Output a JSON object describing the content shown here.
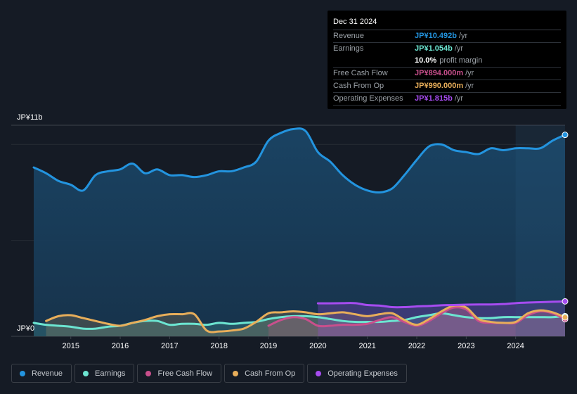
{
  "tooltip": {
    "date": "Dec 31 2024",
    "rows": [
      {
        "label": "Revenue",
        "value": "JP¥10.492b",
        "unit": "/yr",
        "color": "#2394df"
      },
      {
        "label": "Earnings",
        "value": "JP¥1.054b",
        "unit": "/yr",
        "color": "#6ce5d1"
      },
      {
        "label": "",
        "value": "10.0%",
        "unit": "profit margin",
        "color": "#ffffff"
      },
      {
        "label": "Free Cash Flow",
        "value": "JP¥894.000m",
        "unit": "/yr",
        "color": "#c94f8c"
      },
      {
        "label": "Cash From Op",
        "value": "JP¥990.000m",
        "unit": "/yr",
        "color": "#e8ae5a"
      },
      {
        "label": "Operating Expenses",
        "value": "JP¥1.815b",
        "unit": "/yr",
        "color": "#a64cf0"
      }
    ]
  },
  "legend": [
    {
      "label": "Revenue",
      "color": "#2394df"
    },
    {
      "label": "Earnings",
      "color": "#6ce5d1"
    },
    {
      "label": "Free Cash Flow",
      "color": "#c94f8c"
    },
    {
      "label": "Cash From Op",
      "color": "#e8ae5a"
    },
    {
      "label": "Operating Expenses",
      "color": "#a64cf0"
    }
  ],
  "chart_data": {
    "type": "area",
    "title": "",
    "xlabel": "",
    "ylabel": "",
    "y_tick_labels": [
      "JP¥0",
      "JP¥11b"
    ],
    "ylim": [
      0,
      11
    ],
    "xlim": [
      2014.25,
      2025.0
    ],
    "x_tick_labels": [
      "2015",
      "2016",
      "2017",
      "2018",
      "2019",
      "2020",
      "2021",
      "2022",
      "2023",
      "2024"
    ],
    "x_ticks": [
      2015,
      2016,
      2017,
      2018,
      2019,
      2020,
      2021,
      2022,
      2023,
      2024
    ],
    "units": "JP¥ billions",
    "forecast_shade_start": 2024.0,
    "grid": true,
    "series": [
      {
        "name": "Revenue",
        "color": "#2394df",
        "x": [
          2014.25,
          2014.5,
          2014.75,
          2015.0,
          2015.25,
          2015.5,
          2015.75,
          2016.0,
          2016.25,
          2016.5,
          2016.75,
          2017.0,
          2017.25,
          2017.5,
          2017.75,
          2018.0,
          2018.25,
          2018.5,
          2018.75,
          2019.0,
          2019.25,
          2019.5,
          2019.75,
          2020.0,
          2020.25,
          2020.5,
          2020.75,
          2021.0,
          2021.25,
          2021.5,
          2021.75,
          2022.0,
          2022.25,
          2022.5,
          2022.75,
          2023.0,
          2023.25,
          2023.5,
          2023.75,
          2024.0,
          2024.25,
          2024.5,
          2024.75,
          2025.0
        ],
        "values": [
          8.8,
          8.5,
          8.1,
          7.9,
          7.6,
          8.4,
          8.6,
          8.7,
          9.0,
          8.5,
          8.7,
          8.4,
          8.4,
          8.3,
          8.4,
          8.6,
          8.6,
          8.8,
          9.1,
          10.2,
          10.6,
          10.8,
          10.7,
          9.6,
          9.1,
          8.4,
          7.9,
          7.6,
          7.5,
          7.7,
          8.4,
          9.2,
          9.9,
          10.0,
          9.7,
          9.6,
          9.5,
          9.8,
          9.7,
          9.8,
          9.8,
          9.8,
          10.2,
          10.5
        ]
      },
      {
        "name": "Earnings",
        "color": "#6ce5d1",
        "x": [
          2014.25,
          2014.5,
          2014.75,
          2015.0,
          2015.25,
          2015.5,
          2015.75,
          2016.0,
          2016.25,
          2016.5,
          2016.75,
          2017.0,
          2017.25,
          2017.5,
          2017.75,
          2018.0,
          2018.25,
          2018.5,
          2018.75,
          2019.0,
          2019.25,
          2019.5,
          2019.75,
          2020.0,
          2020.25,
          2020.5,
          2020.75,
          2021.0,
          2021.25,
          2021.5,
          2021.75,
          2022.0,
          2022.25,
          2022.5,
          2022.75,
          2023.0,
          2023.25,
          2023.5,
          2023.75,
          2024.0,
          2024.25,
          2024.5,
          2024.75,
          2025.0
        ],
        "values": [
          0.7,
          0.6,
          0.55,
          0.5,
          0.4,
          0.4,
          0.5,
          0.55,
          0.7,
          0.8,
          0.8,
          0.6,
          0.65,
          0.65,
          0.6,
          0.7,
          0.65,
          0.7,
          0.75,
          0.9,
          1.0,
          1.05,
          1.05,
          1.0,
          0.9,
          0.8,
          0.75,
          0.75,
          0.75,
          0.8,
          0.85,
          1.0,
          1.1,
          1.2,
          1.1,
          1.0,
          0.95,
          0.95,
          1.0,
          1.0,
          1.0,
          1.0,
          1.0,
          1.05
        ]
      },
      {
        "name": "Free Cash Flow",
        "color": "#c94f8c",
        "x": [
          2019.0,
          2019.25,
          2019.5,
          2019.75,
          2020.0,
          2020.25,
          2020.5,
          2020.75,
          2021.0,
          2021.25,
          2021.5,
          2021.75,
          2022.0,
          2022.25,
          2022.5,
          2022.75,
          2023.0,
          2023.25,
          2023.5,
          2023.75,
          2024.0,
          2024.25,
          2024.5,
          2024.75,
          2025.0
        ],
        "values": [
          0.55,
          0.85,
          1.0,
          0.9,
          0.55,
          0.55,
          0.6,
          0.6,
          0.65,
          0.85,
          1.0,
          0.75,
          0.55,
          0.8,
          1.2,
          1.5,
          1.4,
          0.8,
          0.7,
          0.7,
          0.7,
          1.1,
          1.3,
          1.2,
          0.89
        ]
      },
      {
        "name": "Cash From Op",
        "color": "#e8ae5a",
        "x": [
          2014.5,
          2014.75,
          2015.0,
          2015.25,
          2015.5,
          2015.75,
          2016.0,
          2016.25,
          2016.5,
          2016.75,
          2017.0,
          2017.25,
          2017.5,
          2017.75,
          2018.0,
          2018.25,
          2018.5,
          2018.75,
          2019.0,
          2019.25,
          2019.5,
          2019.75,
          2020.0,
          2020.25,
          2020.5,
          2020.75,
          2021.0,
          2021.25,
          2021.5,
          2021.75,
          2022.0,
          2022.25,
          2022.5,
          2022.75,
          2023.0,
          2023.25,
          2023.5,
          2023.75,
          2024.0,
          2024.25,
          2024.5,
          2024.75,
          2025.0
        ],
        "values": [
          0.8,
          1.05,
          1.1,
          0.95,
          0.8,
          0.65,
          0.55,
          0.7,
          0.85,
          1.05,
          1.15,
          1.15,
          1.15,
          0.3,
          0.25,
          0.3,
          0.4,
          0.75,
          1.2,
          1.25,
          1.3,
          1.25,
          1.15,
          1.2,
          1.25,
          1.15,
          1.05,
          1.15,
          1.2,
          0.85,
          0.6,
          0.9,
          1.3,
          1.6,
          1.5,
          0.9,
          0.75,
          0.7,
          0.75,
          1.2,
          1.35,
          1.25,
          0.99
        ]
      },
      {
        "name": "Operating Expenses",
        "color": "#a64cf0",
        "x": [
          2020.0,
          2020.25,
          2020.5,
          2020.75,
          2021.0,
          2021.25,
          2021.5,
          2021.75,
          2022.0,
          2022.25,
          2022.5,
          2022.75,
          2023.0,
          2023.25,
          2023.5,
          2023.75,
          2024.0,
          2024.25,
          2024.5,
          2024.75,
          2025.0
        ],
        "values": [
          1.72,
          1.72,
          1.73,
          1.73,
          1.63,
          1.6,
          1.52,
          1.52,
          1.56,
          1.58,
          1.62,
          1.63,
          1.65,
          1.66,
          1.66,
          1.68,
          1.73,
          1.76,
          1.78,
          1.8,
          1.82
        ]
      }
    ]
  }
}
